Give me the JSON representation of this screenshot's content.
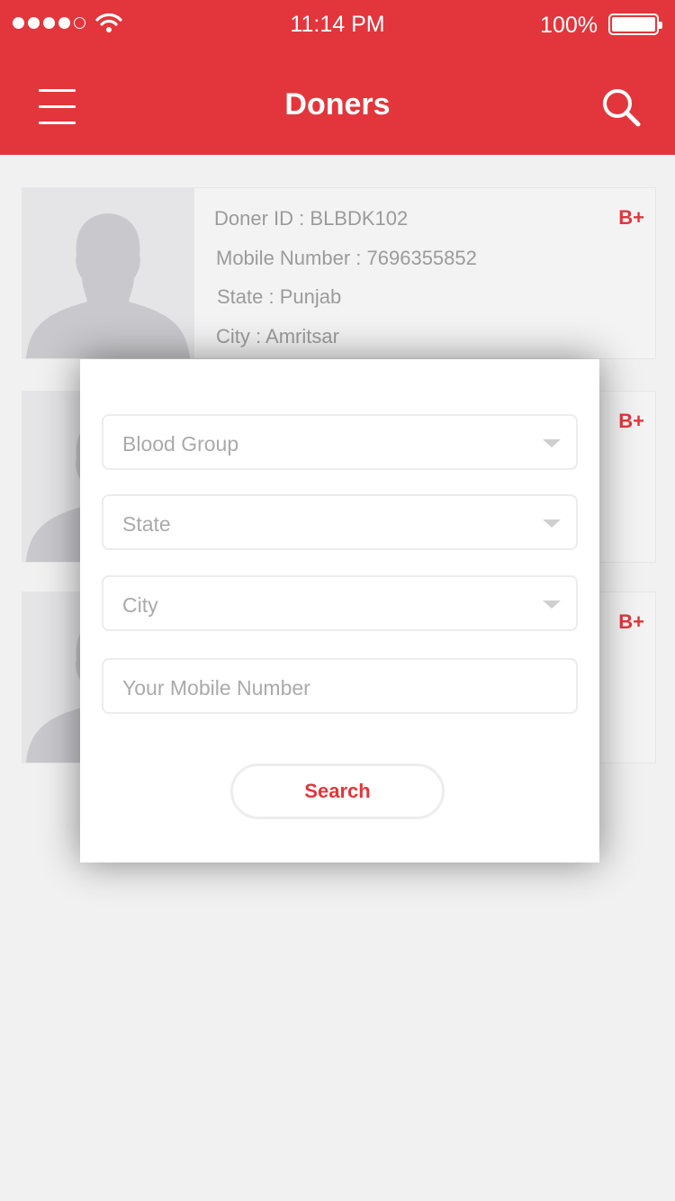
{
  "status_bar": {
    "time": "11:14 PM",
    "battery": "100%",
    "signal_icon": "signal-dots-icon",
    "wifi_icon": "wifi-icon",
    "battery_icon": "battery-icon"
  },
  "header": {
    "title": "Doners",
    "menu_icon": "hamburger-menu-icon",
    "search_icon": "search-icon",
    "color": "#e2363c"
  },
  "donors": [
    {
      "id_label": "Doner ID :",
      "id_value": "BLBDK102",
      "mobile_label": "Mobile Number :",
      "mobile_value": "7696355852",
      "state_label": "State :",
      "state_value": "Punjab",
      "city_label": "City :",
      "city_value": "Amritsar",
      "blood_group": "B+"
    },
    {
      "blood_group": "B+"
    },
    {
      "blood_group": "B+"
    }
  ],
  "filter_modal": {
    "blood_group_placeholder": "Blood Group",
    "state_placeholder": "State",
    "city_placeholder": "City",
    "mobile_placeholder": "Your Mobile Number",
    "search_label": "Search"
  },
  "colors": {
    "accent": "#e2363c",
    "background": "#f1f1f1"
  }
}
